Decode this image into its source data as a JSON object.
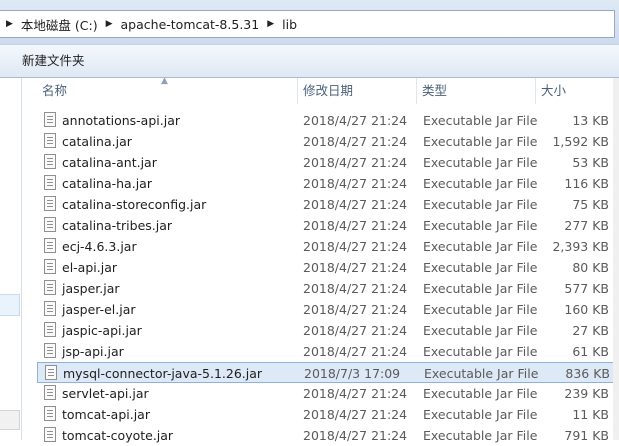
{
  "breadcrumb": {
    "items": [
      "本地磁盘 (C:)",
      "apache-tomcat-8.5.31",
      "lib"
    ]
  },
  "toolbar": {
    "new_folder_label": "新建文件夹"
  },
  "columns": {
    "name": "名称",
    "date": "修改日期",
    "type": "类型",
    "size": "大小"
  },
  "files": [
    {
      "name": "annotations-api.jar",
      "date": "2018/4/27 21:24",
      "type": "Executable Jar File",
      "size": "13 KB"
    },
    {
      "name": "catalina.jar",
      "date": "2018/4/27 21:24",
      "type": "Executable Jar File",
      "size": "1,592 KB"
    },
    {
      "name": "catalina-ant.jar",
      "date": "2018/4/27 21:24",
      "type": "Executable Jar File",
      "size": "53 KB"
    },
    {
      "name": "catalina-ha.jar",
      "date": "2018/4/27 21:24",
      "type": "Executable Jar File",
      "size": "116 KB"
    },
    {
      "name": "catalina-storeconfig.jar",
      "date": "2018/4/27 21:24",
      "type": "Executable Jar File",
      "size": "75 KB"
    },
    {
      "name": "catalina-tribes.jar",
      "date": "2018/4/27 21:24",
      "type": "Executable Jar File",
      "size": "277 KB"
    },
    {
      "name": "ecj-4.6.3.jar",
      "date": "2018/4/27 21:24",
      "type": "Executable Jar File",
      "size": "2,393 KB"
    },
    {
      "name": "el-api.jar",
      "date": "2018/4/27 21:24",
      "type": "Executable Jar File",
      "size": "80 KB"
    },
    {
      "name": "jasper.jar",
      "date": "2018/4/27 21:24",
      "type": "Executable Jar File",
      "size": "577 KB"
    },
    {
      "name": "jasper-el.jar",
      "date": "2018/4/27 21:24",
      "type": "Executable Jar File",
      "size": "160 KB"
    },
    {
      "name": "jaspic-api.jar",
      "date": "2018/4/27 21:24",
      "type": "Executable Jar File",
      "size": "27 KB"
    },
    {
      "name": "jsp-api.jar",
      "date": "2018/4/27 21:24",
      "type": "Executable Jar File",
      "size": "61 KB"
    },
    {
      "name": "mysql-connector-java-5.1.26.jar",
      "date": "2018/7/3 17:09",
      "type": "Executable Jar File",
      "size": "836 KB",
      "selected": true
    },
    {
      "name": "servlet-api.jar",
      "date": "2018/4/27 21:24",
      "type": "Executable Jar File",
      "size": "239 KB"
    },
    {
      "name": "tomcat-api.jar",
      "date": "2018/4/27 21:24",
      "type": "Executable Jar File",
      "size": "11 KB"
    },
    {
      "name": "tomcat-coyote.jar",
      "date": "2018/4/27 21:24",
      "type": "Executable Jar File",
      "size": "791 KB"
    }
  ]
}
